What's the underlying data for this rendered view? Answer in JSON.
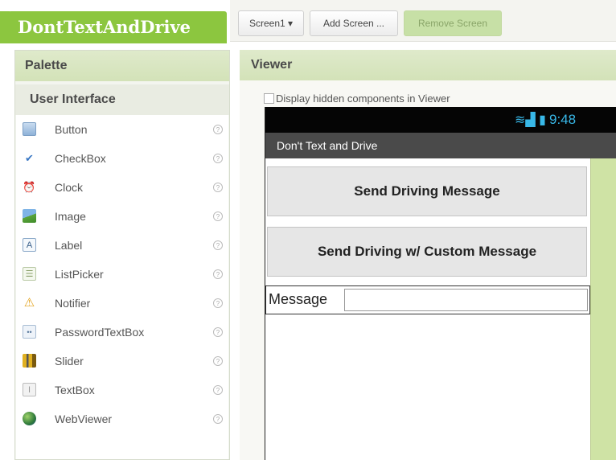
{
  "app": {
    "title": "DontTextAndDrive"
  },
  "toolbar": {
    "screen_select": "Screen1 ▾",
    "add_screen": "Add Screen ...",
    "remove_screen": "Remove Screen"
  },
  "palette": {
    "title": "Palette",
    "section": "User Interface",
    "items": [
      {
        "label": "Button",
        "icon": "button-icon"
      },
      {
        "label": "CheckBox",
        "icon": "checkbox-icon"
      },
      {
        "label": "Clock",
        "icon": "clock-icon"
      },
      {
        "label": "Image",
        "icon": "image-icon"
      },
      {
        "label": "Label",
        "icon": "label-icon"
      },
      {
        "label": "ListPicker",
        "icon": "listpicker-icon"
      },
      {
        "label": "Notifier",
        "icon": "notifier-icon"
      },
      {
        "label": "PasswordTextBox",
        "icon": "password-icon"
      },
      {
        "label": "Slider",
        "icon": "slider-icon"
      },
      {
        "label": "TextBox",
        "icon": "textbox-icon"
      },
      {
        "label": "WebViewer",
        "icon": "webviewer-icon"
      }
    ],
    "help": "?"
  },
  "viewer": {
    "title": "Viewer",
    "hidden_label": "Display hidden components in Viewer",
    "status_time": "9:48",
    "screen_title": "Don't Text and Drive",
    "button1": "Send Driving Message",
    "button2": "Send Driving w/ Custom Message",
    "message_label": "Message",
    "message_value": ""
  },
  "colors": {
    "accent": "#8cc63f",
    "header": "#d3e2b8",
    "status": "#38b8e8"
  }
}
